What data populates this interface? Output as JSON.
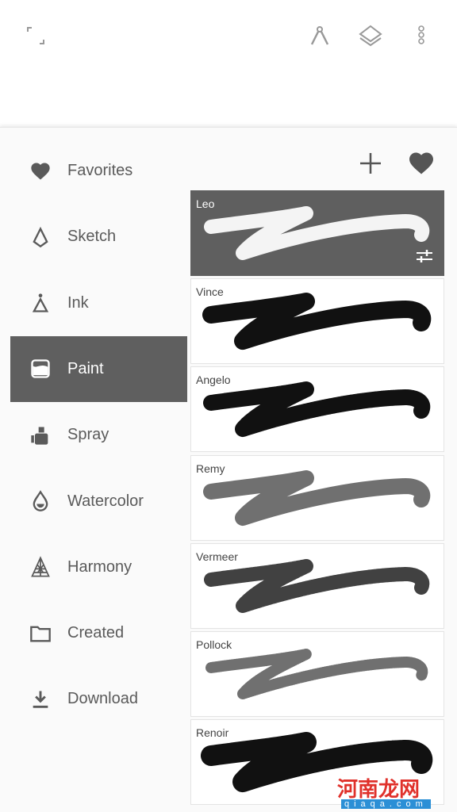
{
  "toolbar": {
    "icons": [
      "fullscreen-icon",
      "ruler-compass-icon",
      "layers-icon",
      "more-vertical-icon"
    ]
  },
  "header": {
    "icons": [
      "add-icon",
      "heart-icon"
    ]
  },
  "sidebar": {
    "selected": "Paint",
    "items": [
      {
        "label": "Favorites",
        "icon": "heart-icon"
      },
      {
        "label": "Sketch",
        "icon": "sketch-pen-icon"
      },
      {
        "label": "Ink",
        "icon": "ink-pen-icon"
      },
      {
        "label": "Paint",
        "icon": "paint-bucket-icon"
      },
      {
        "label": "Spray",
        "icon": "spray-can-icon"
      },
      {
        "label": "Watercolor",
        "icon": "water-drop-icon"
      },
      {
        "label": "Harmony",
        "icon": "harmony-icon"
      },
      {
        "label": "Created",
        "icon": "folder-icon"
      },
      {
        "label": "Download",
        "icon": "download-icon"
      }
    ]
  },
  "brushes": [
    {
      "name": "Leo",
      "selected": true
    },
    {
      "name": "Vince"
    },
    {
      "name": "Angelo"
    },
    {
      "name": "Remy"
    },
    {
      "name": "Vermeer"
    },
    {
      "name": "Pollock"
    },
    {
      "name": "Renoir"
    }
  ],
  "watermark": {
    "title": "河南龙网",
    "url": "qiaqa.com"
  },
  "colors": {
    "selected": "#5f5f5f",
    "icon": "#5a5a5a",
    "panel": "#fafafa"
  }
}
